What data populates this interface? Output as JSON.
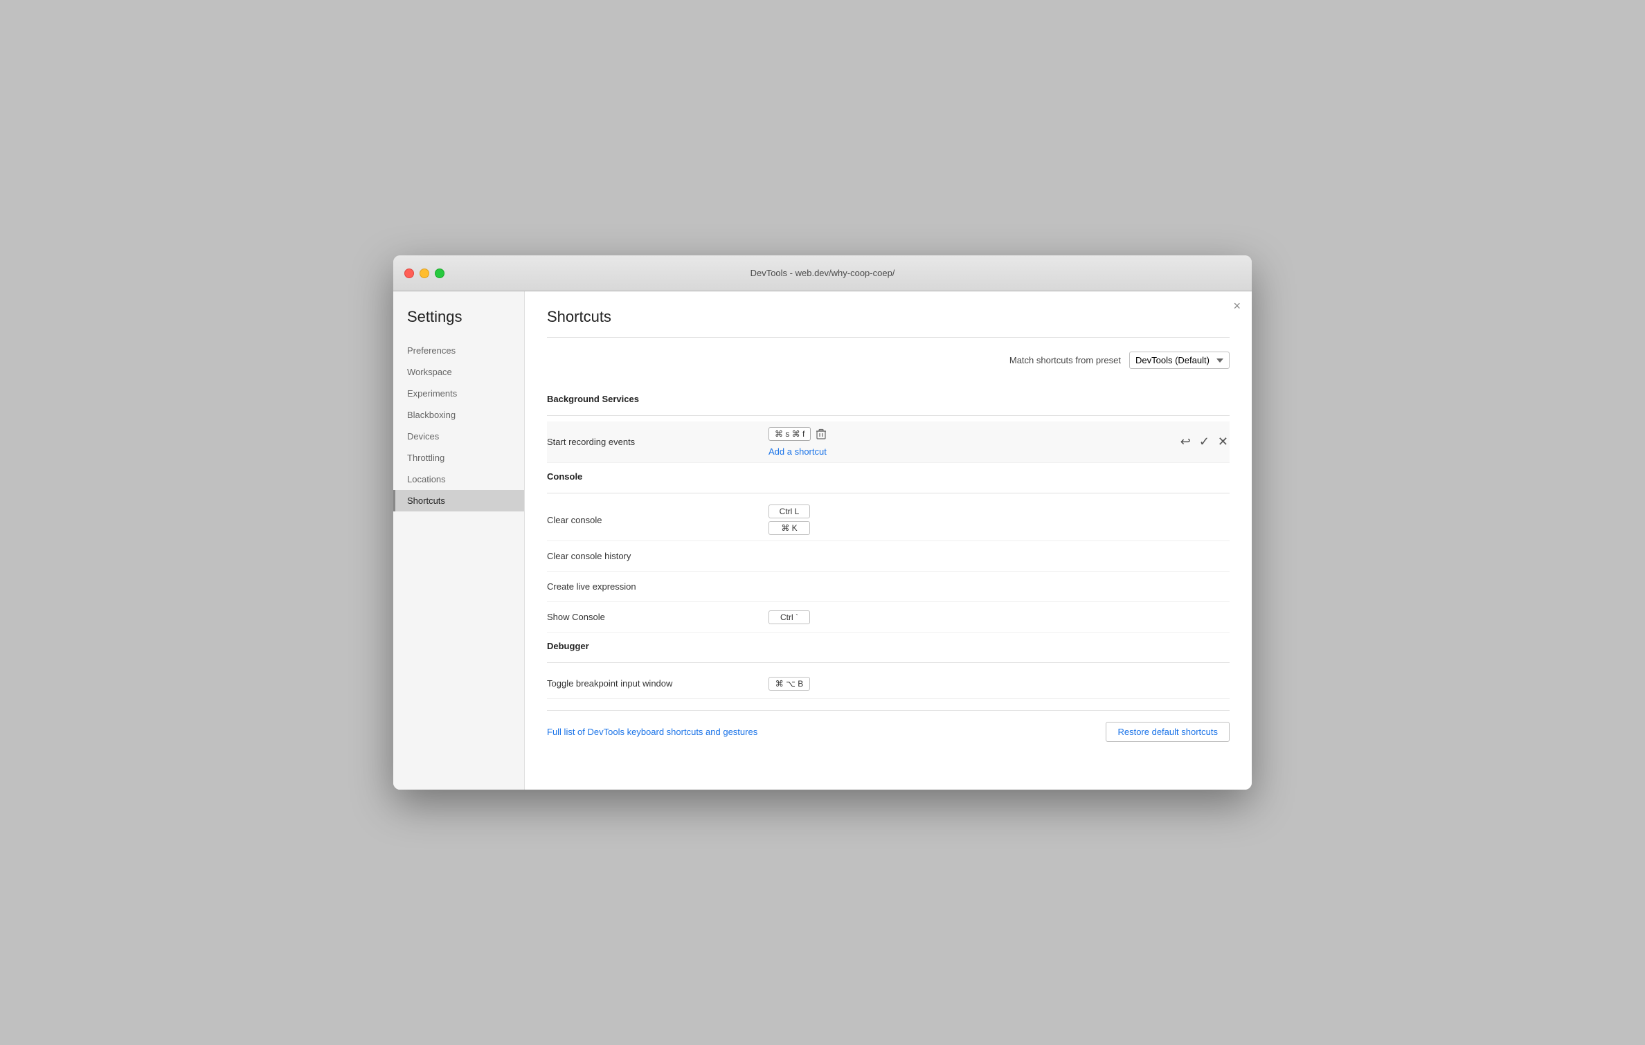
{
  "window": {
    "title": "DevTools - web.dev/why-coop-coep/"
  },
  "sidebar": {
    "title": "Settings",
    "items": [
      {
        "label": "Preferences",
        "active": false
      },
      {
        "label": "Workspace",
        "active": false
      },
      {
        "label": "Experiments",
        "active": false
      },
      {
        "label": "Blackboxing",
        "active": false
      },
      {
        "label": "Devices",
        "active": false
      },
      {
        "label": "Throttling",
        "active": false
      },
      {
        "label": "Locations",
        "active": false
      },
      {
        "label": "Shortcuts",
        "active": true
      }
    ]
  },
  "main": {
    "title": "Shortcuts",
    "preset_label": "Match shortcuts from preset",
    "preset_value": "DevTools (Default)",
    "close_icon": "×",
    "sections": [
      {
        "name": "Background Services",
        "shortcuts": [
          {
            "name": "Start recording events",
            "keys": [
              [
                "⌘ s ⌘ f"
              ]
            ],
            "editing": true,
            "add_shortcut": "Add a shortcut"
          }
        ]
      },
      {
        "name": "Console",
        "shortcuts": [
          {
            "name": "Clear console",
            "keys": [
              [
                "Ctrl L"
              ],
              [
                "⌘ K"
              ]
            ],
            "editing": false
          },
          {
            "name": "Clear console history",
            "keys": [],
            "editing": false
          },
          {
            "name": "Create live expression",
            "keys": [],
            "editing": false
          },
          {
            "name": "Show Console",
            "keys": [
              [
                "Ctrl `"
              ]
            ],
            "editing": false
          }
        ]
      },
      {
        "name": "Debugger",
        "shortcuts": [
          {
            "name": "Toggle breakpoint input window",
            "keys": [
              [
                "⌘ ⌥ B"
              ]
            ],
            "editing": false
          }
        ]
      }
    ],
    "footer": {
      "link_text": "Full list of DevTools keyboard shortcuts and gestures",
      "restore_button": "Restore default shortcuts"
    }
  },
  "icons": {
    "undo": "↩",
    "confirm": "✓",
    "cancel": "×",
    "delete": "🗑",
    "close": "×"
  }
}
